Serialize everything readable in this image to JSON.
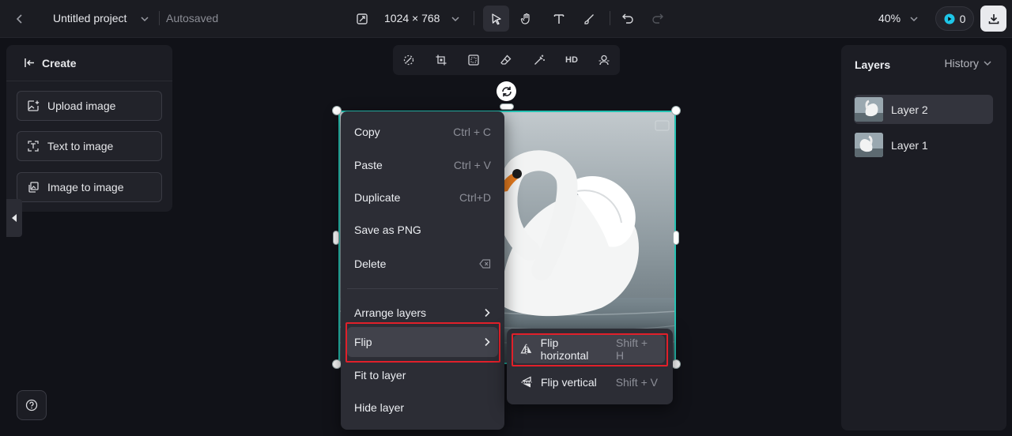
{
  "topbar": {
    "project_name": "Untitled project",
    "autosave_status": "Autosaved",
    "canvas_size": "1024 × 768",
    "zoom": "40%",
    "credits": "0"
  },
  "create_panel": {
    "title": "Create",
    "buttons": [
      {
        "label": "Upload image"
      },
      {
        "label": "Text to image"
      },
      {
        "label": "Image to image"
      }
    ]
  },
  "image_toolbar": {
    "hd_label": "HD"
  },
  "context_menu": {
    "items": [
      {
        "label": "Copy",
        "shortcut": "Ctrl + C"
      },
      {
        "label": "Paste",
        "shortcut": "Ctrl + V"
      },
      {
        "label": "Duplicate",
        "shortcut": "Ctrl+D"
      },
      {
        "label": "Save as PNG",
        "shortcut": ""
      },
      {
        "label": "Delete",
        "shortcut": ""
      },
      {
        "label": "Arrange layers",
        "shortcut": ""
      },
      {
        "label": "Flip",
        "shortcut": ""
      },
      {
        "label": "Fit to layer",
        "shortcut": ""
      },
      {
        "label": "Hide layer",
        "shortcut": ""
      }
    ]
  },
  "flip_submenu": {
    "items": [
      {
        "label": "Flip horizontal",
        "shortcut": "Shift + H"
      },
      {
        "label": "Flip vertical",
        "shortcut": "Shift + V"
      }
    ]
  },
  "layers_panel": {
    "title": "Layers",
    "history_label": "History",
    "layers": [
      {
        "name": "Layer 2"
      },
      {
        "name": "Layer 1"
      }
    ]
  },
  "colors": {
    "selection": "#25c2b3",
    "highlight": "#e0202a",
    "background": "#111218"
  }
}
